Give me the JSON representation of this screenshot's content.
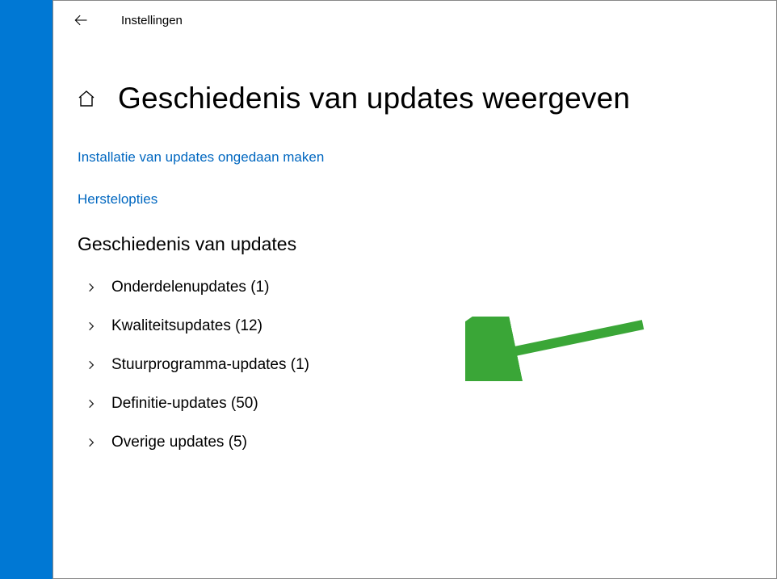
{
  "titlebar": {
    "app_title": "Instellingen"
  },
  "page": {
    "title": "Geschiedenis van updates weergeven"
  },
  "links": {
    "uninstall": "Installatie van updates ongedaan maken",
    "recovery": "Herstelopties"
  },
  "section": {
    "title": "Geschiedenis van updates"
  },
  "categories": [
    {
      "label": "Onderdelenupdates (1)"
    },
    {
      "label": "Kwaliteitsupdates (12)"
    },
    {
      "label": "Stuurprogramma-updates (1)"
    },
    {
      "label": "Definitie-updates (50)"
    },
    {
      "label": "Overige updates (5)"
    }
  ],
  "colors": {
    "link": "#0067c0",
    "accent_arrow": "#3aa637",
    "background": "#0078d4"
  }
}
